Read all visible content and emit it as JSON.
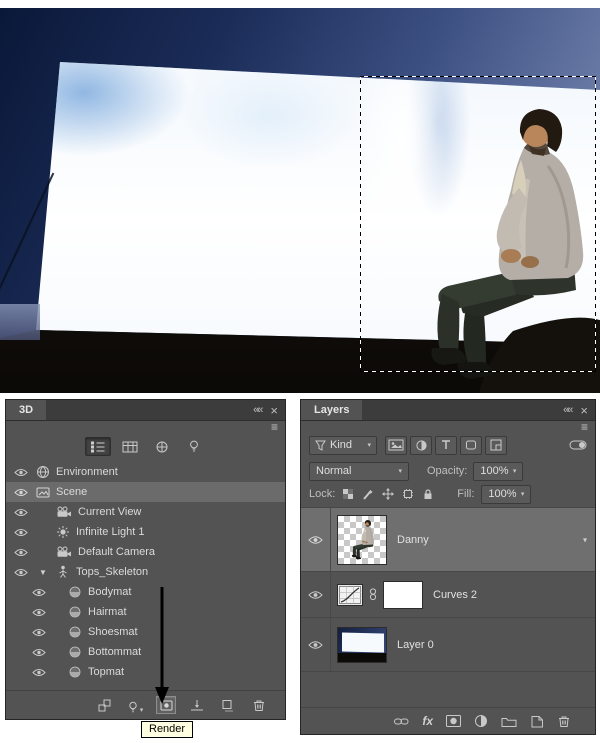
{
  "ui": {
    "collapse_glyph": "««",
    "close_glyph": "×",
    "menu_glyph": "≡",
    "caret_glyph": "▾",
    "expander_open_glyph": "▼"
  },
  "colors": {
    "panel_bg": "#535353",
    "selected_row": "#6e6e6e",
    "tooltip_bg": "#ffffe1",
    "sky_dark": "#0a1838",
    "screen_white": "#ffffff"
  },
  "panel_3d": {
    "tab": "3D",
    "rows": [
      {
        "label": "Environment"
      },
      {
        "label": "Scene"
      },
      {
        "label": "Current View"
      },
      {
        "label": "Infinite Light 1"
      },
      {
        "label": "Default Camera"
      },
      {
        "label": "Tops_Skeleton"
      },
      {
        "label": "Bodymat"
      },
      {
        "label": "Hairmat"
      },
      {
        "label": "Shoesmat"
      },
      {
        "label": "Bottommat"
      },
      {
        "label": "Topmat"
      }
    ],
    "render_tooltip": "Render"
  },
  "panel_layers": {
    "tab": "Layers",
    "kind_label": "Kind",
    "blend_mode": "Normal",
    "opacity_label": "Opacity:",
    "opacity_value": "100%",
    "lock_label": "Lock:",
    "fill_label": "Fill:",
    "fill_value": "100%",
    "fx_label": "fx",
    "layers": [
      {
        "name": "Danny"
      },
      {
        "name": "Curves 2"
      },
      {
        "name": "Layer 0"
      }
    ]
  }
}
